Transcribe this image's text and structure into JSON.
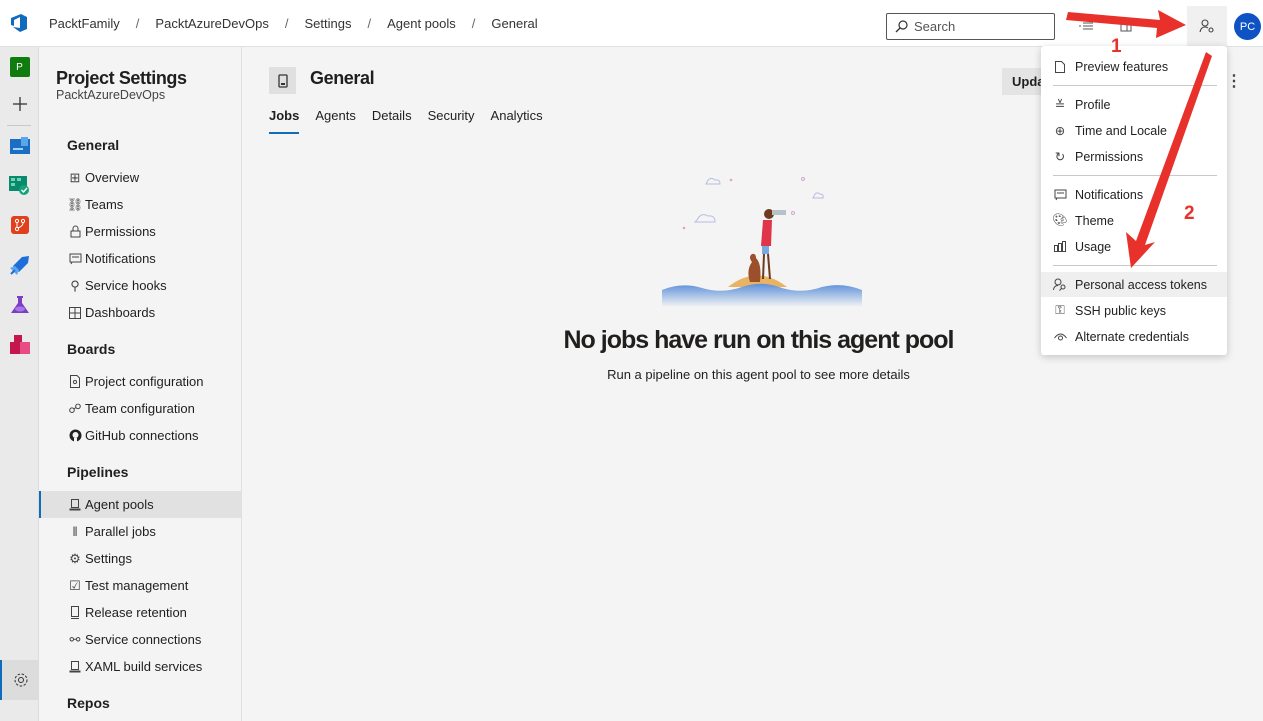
{
  "topbar": {
    "breadcrumb": [
      "PacktFamily",
      "PacktAzureDevOps",
      "Settings",
      "Agent pools",
      "General"
    ],
    "search_placeholder": "Search",
    "avatar_initials": "PC"
  },
  "leftnav": {
    "project_initial": "P",
    "items": [
      "new-item",
      "overview",
      "boards",
      "repos",
      "pipelines",
      "test-plans",
      "artifacts"
    ]
  },
  "settings_panel": {
    "title": "Project Settings",
    "subtitle": "PacktAzureDevOps",
    "sections": [
      {
        "label": "General",
        "items": [
          {
            "label": "Overview",
            "icon": "overview-icon"
          },
          {
            "label": "Teams",
            "icon": "teams-icon"
          },
          {
            "label": "Permissions",
            "icon": "lock-icon"
          },
          {
            "label": "Notifications",
            "icon": "chat-icon"
          },
          {
            "label": "Service hooks",
            "icon": "plug-icon"
          },
          {
            "label": "Dashboards",
            "icon": "dashboard-icon"
          }
        ]
      },
      {
        "label": "Boards",
        "items": [
          {
            "label": "Project configuration",
            "icon": "doc-gear-icon"
          },
          {
            "label": "Team configuration",
            "icon": "team-gear-icon"
          },
          {
            "label": "GitHub connections",
            "icon": "github-icon"
          }
        ]
      },
      {
        "label": "Pipelines",
        "items": [
          {
            "label": "Agent pools",
            "icon": "agent-icon",
            "active": true
          },
          {
            "label": "Parallel jobs",
            "icon": "parallel-icon"
          },
          {
            "label": "Settings",
            "icon": "gear-icon"
          },
          {
            "label": "Test management",
            "icon": "test-icon"
          },
          {
            "label": "Release retention",
            "icon": "retention-icon"
          },
          {
            "label": "Service connections",
            "icon": "connection-icon"
          },
          {
            "label": "XAML build services",
            "icon": "agent-icon"
          }
        ]
      },
      {
        "label": "Repos",
        "items": []
      }
    ]
  },
  "main": {
    "title": "General",
    "tabs": [
      "Jobs",
      "Agents",
      "Details",
      "Security",
      "Analytics"
    ],
    "active_tab": "Jobs",
    "update_button": "Upda",
    "empty_title": "No jobs have run on this agent pool",
    "empty_subtitle": "Run a pipeline on this agent pool to see more details"
  },
  "user_menu": {
    "groups": [
      [
        {
          "label": "Preview features",
          "icon": "page-icon"
        }
      ],
      [
        {
          "label": "Profile",
          "icon": "profile-icon"
        },
        {
          "label": "Time and Locale",
          "icon": "globe-clock-icon"
        },
        {
          "label": "Permissions",
          "icon": "refresh-icon"
        }
      ],
      [
        {
          "label": "Notifications",
          "icon": "chat-icon"
        },
        {
          "label": "Theme",
          "icon": "palette-icon"
        },
        {
          "label": "Usage",
          "icon": "bar-chart-icon"
        }
      ],
      [
        {
          "label": "Personal access tokens",
          "icon": "person-key-icon",
          "hover": true
        },
        {
          "label": "SSH public keys",
          "icon": "keys-icon"
        },
        {
          "label": "Alternate credentials",
          "icon": "eye-icon"
        }
      ]
    ]
  },
  "annotations": {
    "step1": "1",
    "step2": "2",
    "color": "#e8312a"
  }
}
